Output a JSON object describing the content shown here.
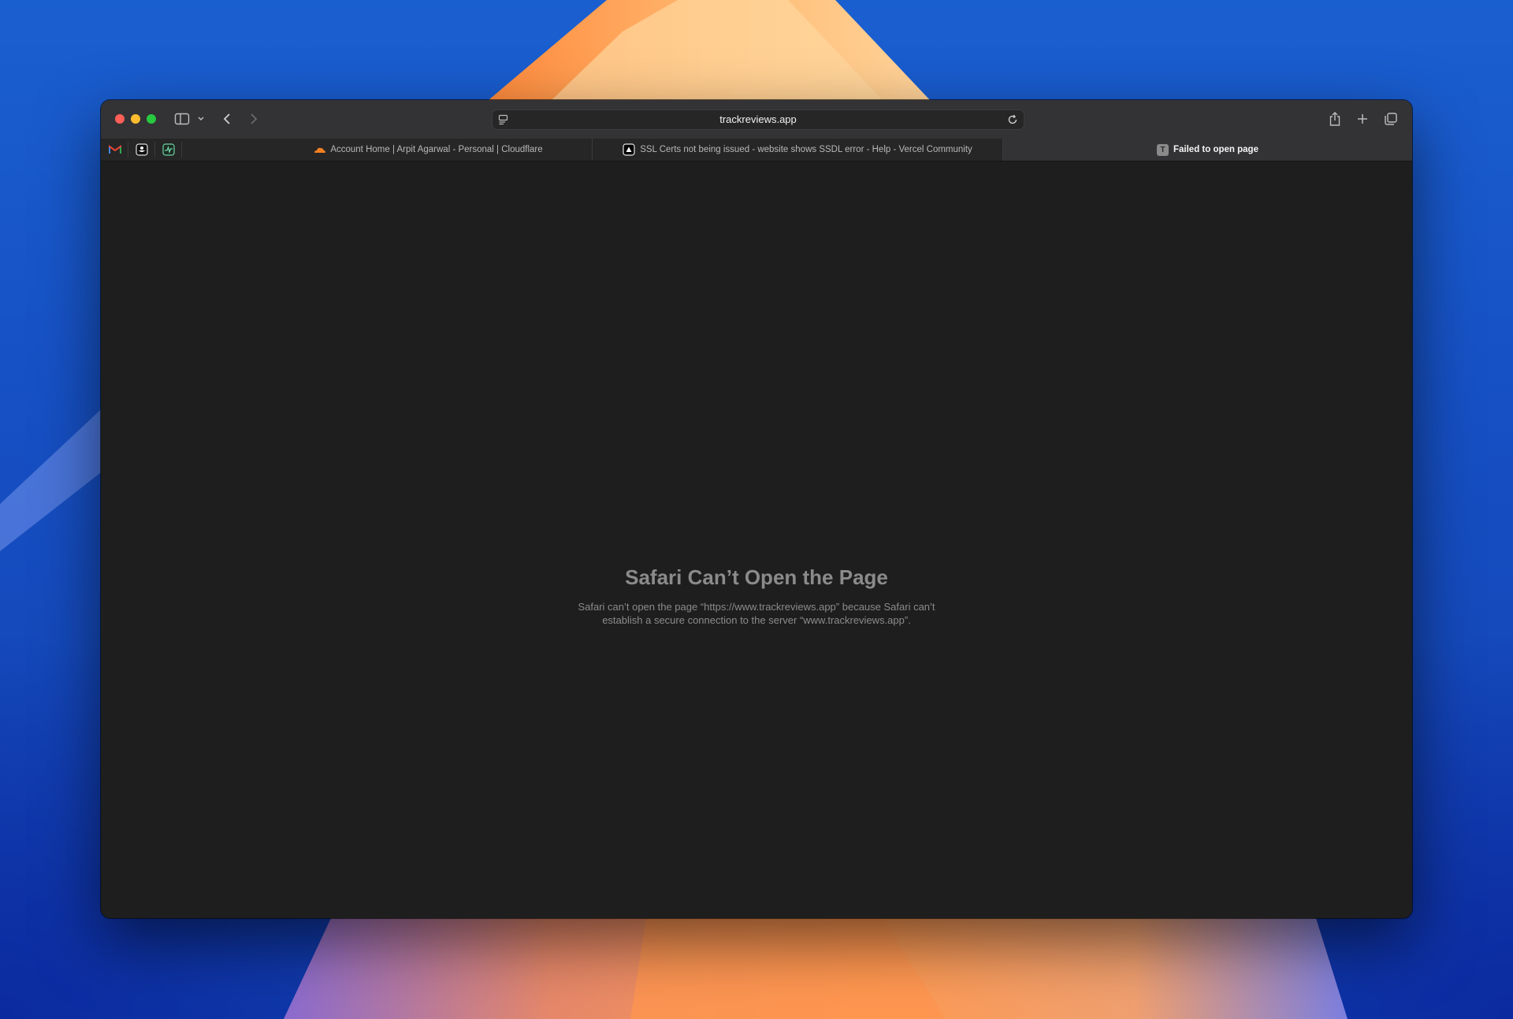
{
  "browser": {
    "address_bar": {
      "url": "trackreviews.app"
    },
    "pinned_tabs": [
      {
        "icon": "gmail-icon"
      },
      {
        "icon": "pinned-app-icon"
      },
      {
        "icon": "pinned-activity-icon"
      }
    ],
    "tabs": [
      {
        "title": "Account Home | Arpit Agarwal - Personal | Cloudflare",
        "icon": "cloudflare-icon",
        "active": false
      },
      {
        "title": "SSL Certs not being issued - website shows SSDL error - Help - Vercel Community",
        "icon": "vercel-icon",
        "active": false
      },
      {
        "title": "Failed to open page",
        "icon": "T",
        "active": true
      }
    ]
  },
  "error_page": {
    "title": "Safari Can’t Open the Page",
    "message": "Safari can’t open the page “https://www.trackreviews.app” because Safari can’t establish a secure connection to the server “www.trackreviews.app”."
  },
  "colors": {
    "window_bg": "#1e1e1e",
    "toolbar_bg": "#333335",
    "close": "#ff5f57",
    "minimize": "#febc2e",
    "maximize": "#28c840",
    "cloudflare": "#f38020"
  }
}
